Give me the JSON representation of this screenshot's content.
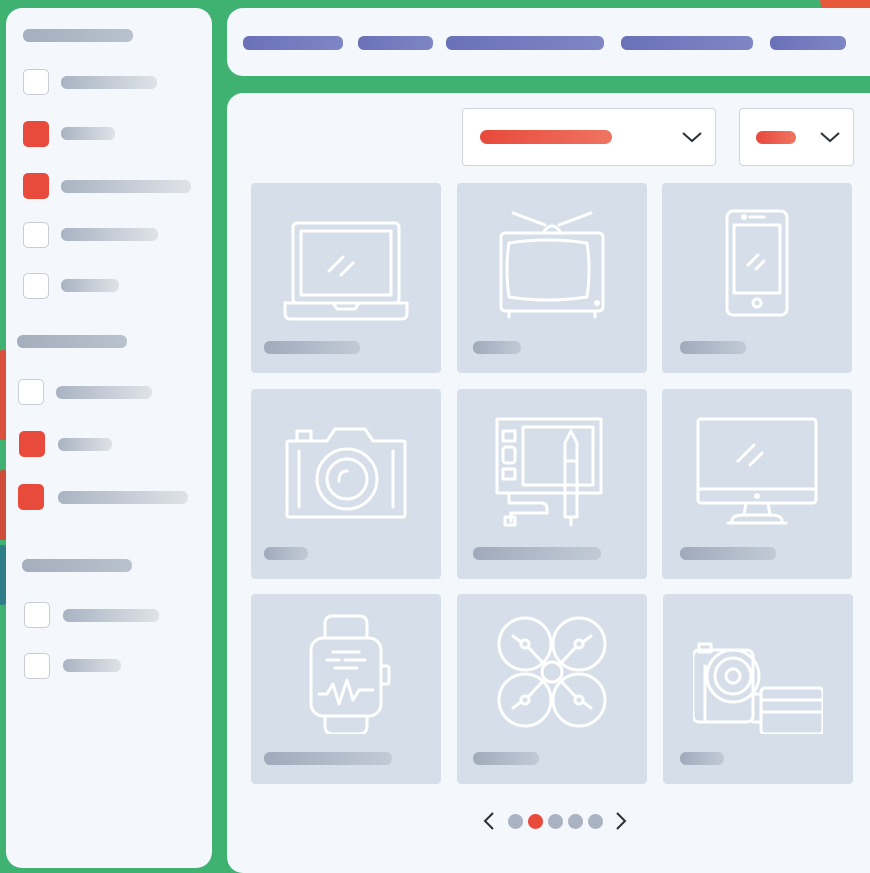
{
  "colors": {
    "background": "#3fb272",
    "panel": "#f4f7fb",
    "accent_red": "#e84b3c",
    "nav_purple": "#6a71b8",
    "card_bg": "#d6dfe9",
    "placeholder_grey": "#a9b3c2"
  },
  "sidebar": {
    "groups": [
      {
        "heading": "",
        "items": [
          {
            "label": "",
            "checked": false
          },
          {
            "label": "",
            "checked": true
          },
          {
            "label": "",
            "checked": true
          },
          {
            "label": "",
            "checked": false
          },
          {
            "label": "",
            "checked": false
          }
        ]
      },
      {
        "heading": "",
        "items": [
          {
            "label": "",
            "checked": false
          },
          {
            "label": "",
            "checked": true
          },
          {
            "label": "",
            "checked": true
          }
        ]
      },
      {
        "heading": "",
        "items": [
          {
            "label": "",
            "checked": false
          },
          {
            "label": "",
            "checked": false
          }
        ]
      }
    ]
  },
  "nav": {
    "items": [
      "",
      "",
      "",
      "",
      ""
    ]
  },
  "filters": {
    "sort_select": {
      "value": ""
    },
    "count_select": {
      "value": ""
    }
  },
  "products": [
    {
      "icon": "laptop-icon",
      "title": ""
    },
    {
      "icon": "tv-icon",
      "title": ""
    },
    {
      "icon": "smartphone-icon",
      "title": ""
    },
    {
      "icon": "camera-icon",
      "title": ""
    },
    {
      "icon": "drawing-tablet-icon",
      "title": ""
    },
    {
      "icon": "monitor-icon",
      "title": ""
    },
    {
      "icon": "smartwatch-icon",
      "title": ""
    },
    {
      "icon": "drone-icon",
      "title": ""
    },
    {
      "icon": "camcorder-icon",
      "title": ""
    }
  ],
  "pagination": {
    "total_pages": 5,
    "current_page": 2
  }
}
